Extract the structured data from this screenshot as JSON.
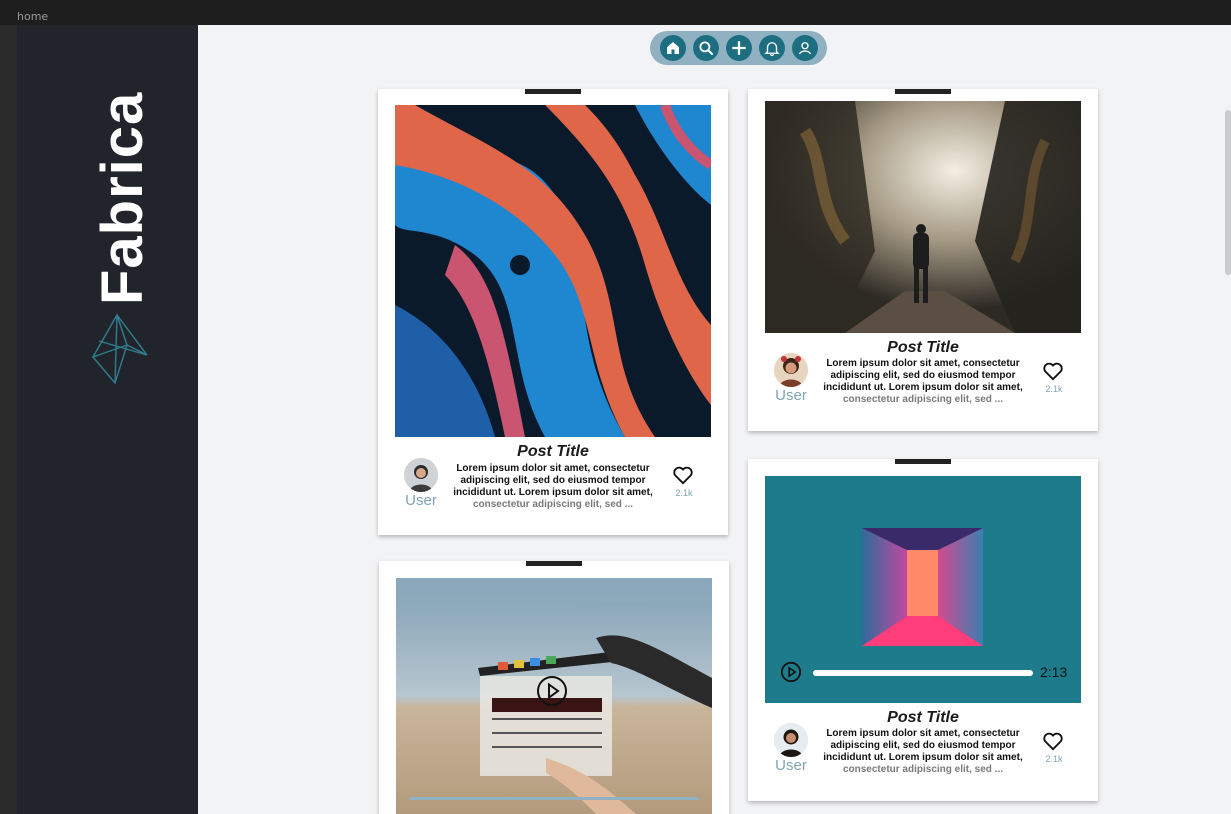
{
  "frame_label": "home",
  "brand": {
    "name": "Fabrica"
  },
  "nav": [
    {
      "name": "home",
      "icon": "home-icon"
    },
    {
      "name": "search",
      "icon": "search-icon"
    },
    {
      "name": "create",
      "icon": "plus-icon"
    },
    {
      "name": "notifications",
      "icon": "bell-icon"
    },
    {
      "name": "profile",
      "icon": "user-icon"
    }
  ],
  "posts": [
    {
      "title": "Post Title",
      "user": "User",
      "body": "Lorem ipsum dolor sit amet, consectetur adipiscing elit, sed do eiusmod tempor incididunt ut. Lorem ipsum dolor sit amet,",
      "body_fade": "consectetur adipiscing elit, sed ...",
      "likes": "2.1k"
    },
    {
      "title": "Post Title",
      "user": "User",
      "body": "Lorem ipsum dolor sit amet, consectetur adipiscing elit, sed do eiusmod tempor incididunt ut. Lorem ipsum dolor sit amet,",
      "body_fade": "consectetur adipiscing elit, sed ...",
      "likes": "2.1k"
    },
    {
      "title": "Post Title",
      "user": "User",
      "body": "Lorem ipsum dolor sit amet, consectetur adipiscing elit, sed do eiusmod tempor incididunt ut. Lorem ipsum dolor sit amet,",
      "body_fade": "consectetur adipiscing elit, sed ...",
      "likes": "2.1k",
      "audio_time": "2:13"
    }
  ],
  "colors": {
    "sidebar": "#21252b",
    "canvas": "#f2f3f5",
    "accent": "#1e6e82",
    "nav_pill": "#8fb1c2",
    "audio_panel": "#1e7b8c",
    "muted": "#7fa3b4"
  }
}
